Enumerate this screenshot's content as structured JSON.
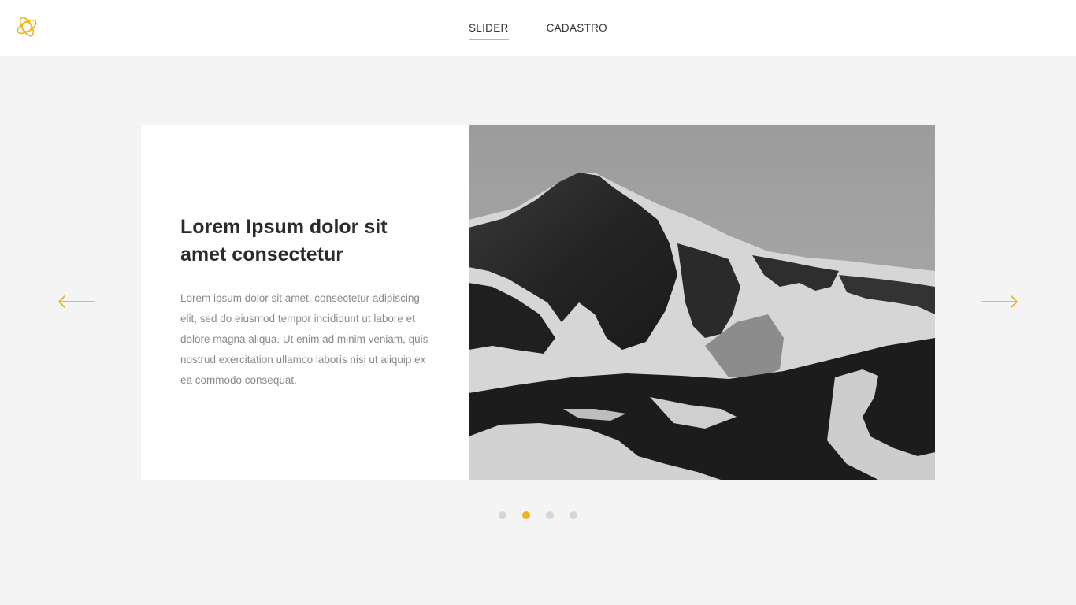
{
  "brand": {
    "accent_color": "#f0b41c",
    "logo_icon": "triquetra-logo-icon"
  },
  "nav": {
    "items": [
      {
        "label": "SLIDER",
        "active": true
      },
      {
        "label": "CADASTRO",
        "active": false
      }
    ]
  },
  "slide": {
    "title": "Lorem Ipsum dolor sit amet consectetur",
    "body": "Lorem ipsum dolor sit amet, consectetur adipiscing elit, sed do eiusmod tempor incididunt ut labore et dolore magna aliqua. Ut enim ad minim veniam, quis nostrud exercitation ullamco laboris nisi ut aliquip ex ea commodo consequat.",
    "image": "grayscale-snowy-mountain-photo"
  },
  "controls": {
    "prev_icon": "arrow-left-icon",
    "next_icon": "arrow-right-icon",
    "dot_count": 4,
    "active_dot": 2
  }
}
